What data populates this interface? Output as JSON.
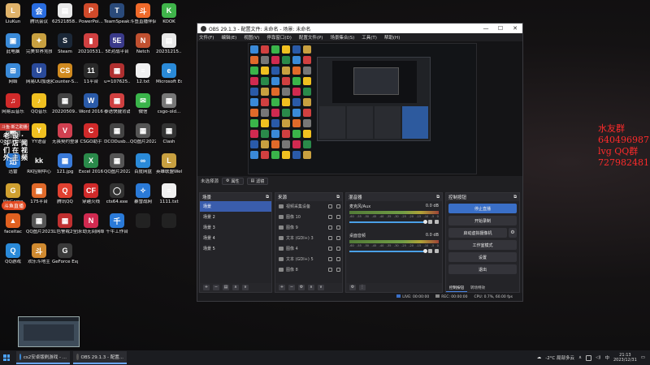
{
  "desktop": {
    "icons": [
      {
        "label": "LiuKun",
        "color": "#e0b36a",
        "glyph": "L"
      },
      {
        "label": "腾讯会议",
        "color": "#2a6de0",
        "glyph": "会"
      },
      {
        "label": "62521858...",
        "color": "#e8e8e8",
        "glyph": "▤"
      },
      {
        "label": "PowerPoi...",
        "color": "#d04a2a",
        "glyph": "P"
      },
      {
        "label": "TeamSpeak 3",
        "color": "#2a4a7a",
        "glyph": "T"
      },
      {
        "label": "斗鱼直播伴侣",
        "color": "#f06a2a",
        "glyph": "斗"
      },
      {
        "label": "KOOK",
        "color": "#3fb44a",
        "glyph": "K"
      },
      {
        "label": "此电脑",
        "color": "#3a8ad8",
        "glyph": "▣"
      },
      {
        "label": "完美世界竞技平台",
        "color": "#c8a040",
        "glyph": "✦"
      },
      {
        "label": "Steam",
        "color": "#1b2838",
        "glyph": "S"
      },
      {
        "label": "20210531...",
        "color": "#d04040",
        "glyph": "▮"
      },
      {
        "label": "5E对战平台",
        "color": "#3a3a8a",
        "glyph": "5E"
      },
      {
        "label": "Netch",
        "color": "#c05030",
        "glyph": "N"
      },
      {
        "label": "20231215...",
        "color": "#e8e8e8",
        "glyph": "▤"
      },
      {
        "label": "网络",
        "color": "#3a8ad8",
        "glyph": "⊞"
      },
      {
        "label": "网易UU加速器",
        "color": "#2a4a9a",
        "glyph": "U"
      },
      {
        "label": "Counter-S...",
        "color": "#d08a20",
        "glyph": "CS"
      },
      {
        "label": "11平台",
        "color": "#2a2a2a",
        "glyph": "11"
      },
      {
        "label": "u=107625...",
        "color": "#b03030",
        "glyph": "▦"
      },
      {
        "label": "12.txt",
        "color": "#f0f0f0",
        "glyph": "≡"
      },
      {
        "label": "Microsoft Edge",
        "color": "#2a8ad8",
        "glyph": "e"
      },
      {
        "label": "网易云音乐",
        "color": "#d02a2a",
        "glyph": "♫"
      },
      {
        "label": "QQ音乐",
        "color": "#f0c020",
        "glyph": "♪"
      },
      {
        "label": "20220509...",
        "color": "#444",
        "glyph": "▦"
      },
      {
        "label": "Word 2016",
        "color": "#2a5aa8",
        "glyph": "W"
      },
      {
        "label": "泰语快捷背诵",
        "color": "#d04040",
        "glyph": "▦"
      },
      {
        "label": "微信",
        "color": "#3ab44a",
        "glyph": "✉"
      },
      {
        "label": "csgo-old...",
        "color": "#777",
        "glyph": "▦"
      },
      {
        "label": "QQ图片20220509...",
        "color": "#666",
        "glyph": "▦"
      },
      {
        "label": "YY语音",
        "color": "#f0c020",
        "glyph": "Y"
      },
      {
        "label": "无畏契约登录器.exe",
        "color": "#d04050",
        "glyph": "V"
      },
      {
        "label": "CSGO助手",
        "color": "#d02a2a",
        "glyph": "C"
      },
      {
        "label": "DCODusb...",
        "color": "#444",
        "glyph": "▦"
      },
      {
        "label": "QQ图片20220904...",
        "color": "#555",
        "glyph": "▦"
      },
      {
        "label": "Clash",
        "color": "#333",
        "glyph": "▦"
      },
      {
        "label": "迅雷",
        "color": "#2a7ad8",
        "glyph": "迅"
      },
      {
        "label": "RK控制中心",
        "color": "#111",
        "glyph": "kk"
      },
      {
        "label": "121.jpg",
        "color": "#3a7ad8",
        "glyph": "▦"
      },
      {
        "label": "Excel 2016",
        "color": "#2a8a4a",
        "glyph": "X"
      },
      {
        "label": "QQ图片20221129...",
        "color": "#555",
        "glyph": "▦"
      },
      {
        "label": "百度网盘",
        "color": "#2a8ad8",
        "glyph": "∞"
      },
      {
        "label": "英雄联盟WeGame版",
        "color": "#c8a040",
        "glyph": "L"
      },
      {
        "label": "WeGame",
        "color": "#d0a030",
        "glyph": "G"
      },
      {
        "label": "175平台",
        "color": "#e06a2a",
        "glyph": "▦"
      },
      {
        "label": "腾讯QQ",
        "color": "#e04030",
        "glyph": "Q"
      },
      {
        "label": "穿越火线",
        "color": "#d02a2a",
        "glyph": "CF"
      },
      {
        "label": "cts64.exe",
        "color": "#333",
        "glyph": "◯"
      },
      {
        "label": "暴雪战网",
        "color": "#2a7ad8",
        "glyph": "✧"
      },
      {
        "label": "1111.txt",
        "color": "#f0f0f0",
        "glyph": "≡"
      },
      {
        "label": "faceitac",
        "color": "#e06020",
        "glyph": "▲"
      },
      {
        "label": "QQ图片20230512...",
        "color": "#555",
        "glyph": "▦"
      },
      {
        "label": "红色警戒2全国明星联赛",
        "color": "#c03030",
        "glyph": "▦"
      },
      {
        "label": "永劫无间网络游戏",
        "color": "#d02a50",
        "glyph": "N"
      },
      {
        "label": "千牛工作台",
        "color": "#2a7ad8",
        "glyph": "千"
      },
      {
        "label": "",
        "color": "#222",
        "glyph": ""
      },
      {
        "label": "",
        "color": "#222",
        "glyph": ""
      },
      {
        "label": "QQ游戏",
        "color": "#2a8ad8",
        "glyph": "Q"
      },
      {
        "label": "欢乐斗地主",
        "color": "#d08a30",
        "glyph": "斗"
      },
      {
        "label": "GeForce Experience",
        "color": "#3a3a3a",
        "glyph": "G"
      }
    ],
    "live_overlay": {
      "top_label": "斗鱼·新之助播·开播",
      "vertical_cols": [
        "老斗们外",
        "设店在主",
        "·闻视频"
      ],
      "badge": "斗鱼直播"
    },
    "fan_text": [
      "水友群",
      "640496987",
      "lvg QQ群",
      "727982481"
    ],
    "fan_tiny": "白天不代练 · 晚上更新 · 本群不卖号"
  },
  "obs": {
    "title": "OBS 29.1.3 - 配置文件: 未命名 - 场景: 未命名",
    "window_controls": {
      "minimize": "—",
      "maximize": "☐",
      "close": "✕"
    },
    "menu": [
      "文件(F)",
      "编辑(E)",
      "视图(V)",
      "停靠窗口(D)",
      "配置文件(P)",
      "场景集合(S)",
      "工具(T)",
      "帮助(H)"
    ],
    "scene_bar": {
      "label": "未选择源",
      "properties": "属性",
      "filters": "滤镜"
    },
    "scenes": {
      "title": "场景",
      "items": [
        "场景",
        "场景 2",
        "场景 3",
        "场景 4",
        "场景 5"
      ],
      "active_index": 0
    },
    "sources": {
      "title": "来源",
      "items": [
        "视频采集设备",
        "图像 10",
        "图像 9",
        "文本 (GDI+) 3",
        "图像 4",
        "文本 (GDI+) 5",
        "图像 8"
      ]
    },
    "mixer": {
      "title": "混音器",
      "tracks": [
        {
          "name": "麦克风/Aux",
          "db": "0.0 dB"
        },
        {
          "name": "桌面音频",
          "db": "0.0 dB"
        }
      ],
      "scale": [
        "-60",
        "-55",
        "-50",
        "-45",
        "-40",
        "-35",
        "-30",
        "-25",
        "-20",
        "-15",
        "-10",
        "-5",
        "0"
      ]
    },
    "controls": {
      "title": "控制按钮",
      "stop_streaming": "停止直播",
      "start_recording": "开始录制",
      "virtual_camera": "启动虚拟摄像机",
      "studio_mode": "工作室模式",
      "settings": "设置",
      "exit": "退出",
      "tab_controls": "控制按钮",
      "tab_transitions": "转场特效"
    },
    "status": {
      "live": "LIVE: 00:00:00",
      "rec": "REC: 00:00:00",
      "cpu": "CPU: 0.7%, 60.00 fps"
    }
  },
  "taskbar": {
    "tasks": [
      {
        "label": "cs2安卓版刷游戏 - ...",
        "color": "#3a8ad8"
      },
      {
        "label": "OBS 29.1.3 - 配置...",
        "color": "#555"
      }
    ],
    "weather": "-2°C 局部多云",
    "ime": "中",
    "time": "21:13",
    "date": "2023/12/31"
  },
  "colors": {
    "accent": "#3a6fc7",
    "fan_text": "#ff2b2b",
    "active_scene": "#3a5dad"
  }
}
